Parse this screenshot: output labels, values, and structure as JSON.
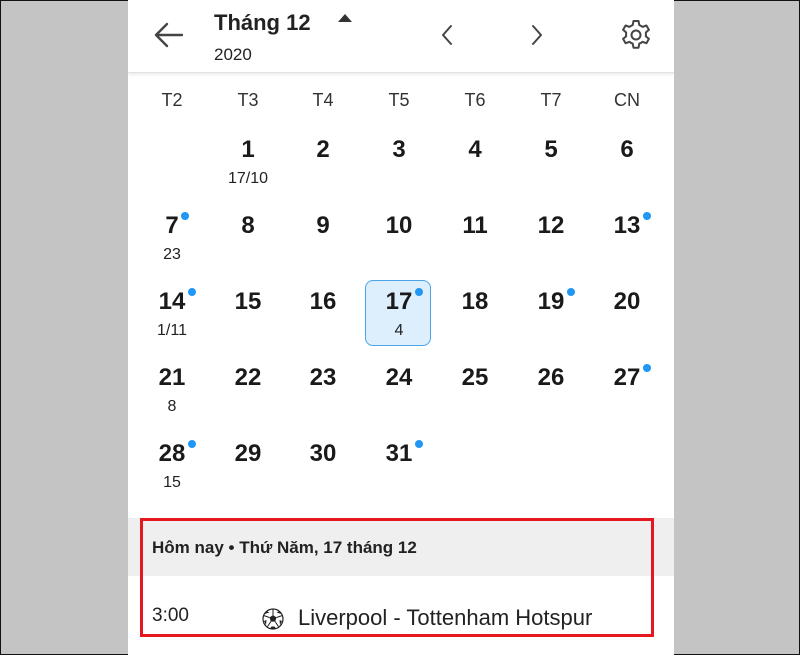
{
  "header": {
    "month_title": "Tháng 12",
    "year": "2020"
  },
  "weekdays": [
    "T2",
    "T3",
    "T4",
    "T5",
    "T6",
    "T7",
    "CN"
  ],
  "calendar": {
    "days": [
      {
        "day": "1",
        "lunar": "17/10",
        "col": 1,
        "row": 0,
        "dot": false
      },
      {
        "day": "2",
        "lunar": "",
        "col": 2,
        "row": 0,
        "dot": false
      },
      {
        "day": "3",
        "lunar": "",
        "col": 3,
        "row": 0,
        "dot": false
      },
      {
        "day": "4",
        "lunar": "",
        "col": 4,
        "row": 0,
        "dot": false
      },
      {
        "day": "5",
        "lunar": "",
        "col": 5,
        "row": 0,
        "dot": false
      },
      {
        "day": "6",
        "lunar": "",
        "col": 6,
        "row": 0,
        "dot": false
      },
      {
        "day": "7",
        "lunar": "23",
        "col": 0,
        "row": 1,
        "dot": true
      },
      {
        "day": "8",
        "lunar": "",
        "col": 1,
        "row": 1,
        "dot": false
      },
      {
        "day": "9",
        "lunar": "",
        "col": 2,
        "row": 1,
        "dot": false
      },
      {
        "day": "10",
        "lunar": "",
        "col": 3,
        "row": 1,
        "dot": false
      },
      {
        "day": "11",
        "lunar": "",
        "col": 4,
        "row": 1,
        "dot": false
      },
      {
        "day": "12",
        "lunar": "",
        "col": 5,
        "row": 1,
        "dot": false
      },
      {
        "day": "13",
        "lunar": "",
        "col": 6,
        "row": 1,
        "dot": true
      },
      {
        "day": "14",
        "lunar": "1/11",
        "col": 0,
        "row": 2,
        "dot": true
      },
      {
        "day": "15",
        "lunar": "",
        "col": 1,
        "row": 2,
        "dot": false
      },
      {
        "day": "16",
        "lunar": "",
        "col": 2,
        "row": 2,
        "dot": false
      },
      {
        "day": "17",
        "lunar": "4",
        "col": 3,
        "row": 2,
        "dot": true,
        "selected": true
      },
      {
        "day": "18",
        "lunar": "",
        "col": 4,
        "row": 2,
        "dot": false
      },
      {
        "day": "19",
        "lunar": "",
        "col": 5,
        "row": 2,
        "dot": true
      },
      {
        "day": "20",
        "lunar": "",
        "col": 6,
        "row": 2,
        "dot": false
      },
      {
        "day": "21",
        "lunar": "8",
        "col": 0,
        "row": 3,
        "dot": false
      },
      {
        "day": "22",
        "lunar": "",
        "col": 1,
        "row": 3,
        "dot": false
      },
      {
        "day": "23",
        "lunar": "",
        "col": 2,
        "row": 3,
        "dot": false
      },
      {
        "day": "24",
        "lunar": "",
        "col": 3,
        "row": 3,
        "dot": false
      },
      {
        "day": "25",
        "lunar": "",
        "col": 4,
        "row": 3,
        "dot": false
      },
      {
        "day": "26",
        "lunar": "",
        "col": 5,
        "row": 3,
        "dot": false
      },
      {
        "day": "27",
        "lunar": "",
        "col": 6,
        "row": 3,
        "dot": true
      },
      {
        "day": "28",
        "lunar": "15",
        "col": 0,
        "row": 4,
        "dot": true
      },
      {
        "day": "29",
        "lunar": "",
        "col": 1,
        "row": 4,
        "dot": false
      },
      {
        "day": "30",
        "lunar": "",
        "col": 2,
        "row": 4,
        "dot": false
      },
      {
        "day": "31",
        "lunar": "",
        "col": 3,
        "row": 4,
        "dot": true
      }
    ]
  },
  "today": {
    "title": "Hôm nay • Thứ Năm, 17 tháng 12",
    "event_time": "3:00",
    "event_icon": "soccer-ball-icon",
    "event_name": "Liverpool - Tottenham Hotspur"
  },
  "colors": {
    "accent_dot": "#2196f3",
    "selected_bg": "#ddeffc",
    "selected_border": "#4aa4e8",
    "highlight_frame": "#e4181e"
  }
}
